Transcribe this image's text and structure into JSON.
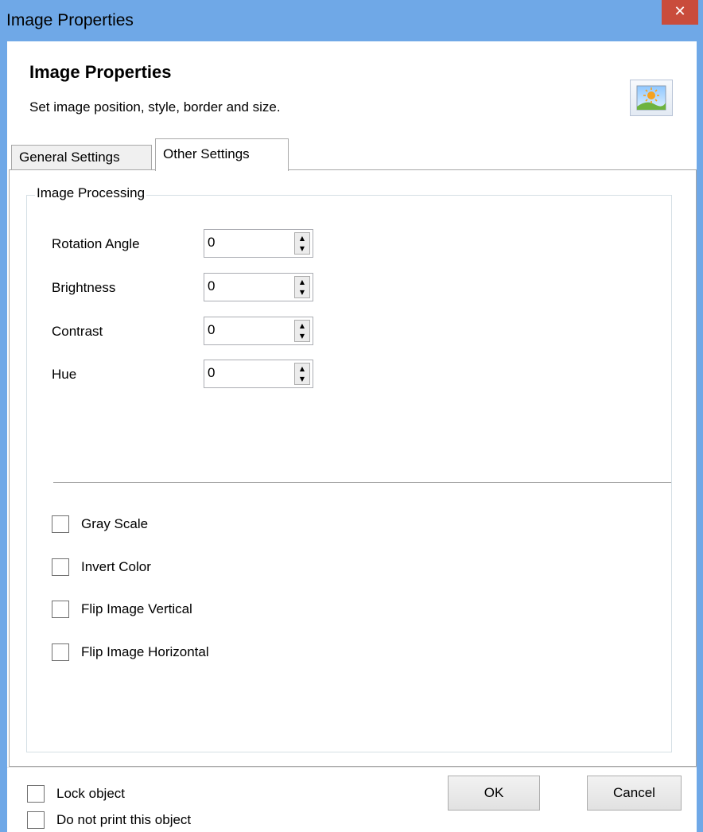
{
  "window": {
    "title": "Image Properties",
    "close_glyph": "✕"
  },
  "header": {
    "title": "Image Properties",
    "subtitle": "Set image position, style, border and size.",
    "icon": "picture-icon"
  },
  "tabs": [
    {
      "label": "General Settings",
      "active": false
    },
    {
      "label": "Other Settings",
      "active": true
    }
  ],
  "image_processing": {
    "legend": "Image Processing",
    "fields": [
      {
        "label": "Rotation Angle",
        "value": "0"
      },
      {
        "label": "Brightness",
        "value": "0"
      },
      {
        "label": "Contrast",
        "value": "0"
      },
      {
        "label": "Hue",
        "value": "0"
      }
    ],
    "checkboxes": [
      {
        "label": "Gray Scale",
        "checked": false
      },
      {
        "label": "Invert Color",
        "checked": false
      },
      {
        "label": "Flip Image Vertical",
        "checked": false
      },
      {
        "label": "Flip Image Horizontal",
        "checked": false
      }
    ]
  },
  "footer": {
    "lock_label": "Lock object",
    "lock_checked": false,
    "noprint_label": "Do not print this object",
    "noprint_checked": false,
    "ok_label": "OK",
    "cancel_label": "Cancel"
  },
  "colors": {
    "titlebar": "#6fa8e7",
    "close": "#c94c3c"
  }
}
